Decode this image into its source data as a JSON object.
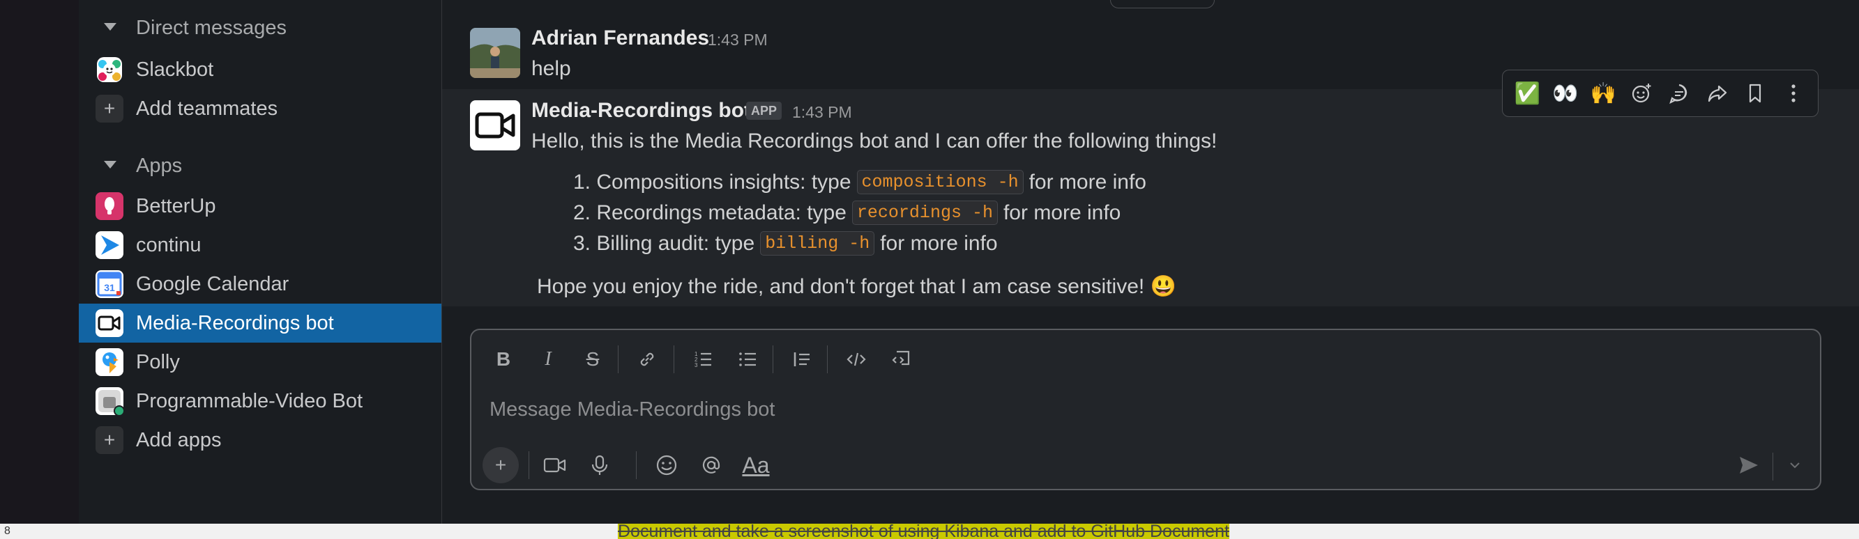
{
  "sidebar": {
    "dm_section": "Direct messages",
    "slackbot": "Slackbot",
    "add_teammates": "Add teammates",
    "apps_section": "Apps",
    "apps": [
      {
        "label": "BetterUp"
      },
      {
        "label": "continu"
      },
      {
        "label": "Google Calendar"
      },
      {
        "label": "Media-Recordings bot"
      },
      {
        "label": "Polly"
      },
      {
        "label": "Programmable-Video Bot"
      }
    ],
    "add_apps": "Add apps",
    "calendar_day": "31"
  },
  "messages": [
    {
      "author": "Adrian Fernandes",
      "time": "1:43 PM",
      "text": "help"
    },
    {
      "author": "Media-Recordings bot",
      "badge": "APP",
      "time": "1:43 PM",
      "intro": "Hello, this is the Media Recordings bot and I can offer the following things!",
      "items": [
        {
          "num": "1.",
          "pre": "Compositions insights: type",
          "code": "compositions -h",
          "post": "for more info"
        },
        {
          "num": "2.",
          "pre": "Recordings metadata: type",
          "code": "recordings -h",
          "post": "for more info"
        },
        {
          "num": "3.",
          "pre": "Billing audit: type",
          "code": "billing -h",
          "post": "for more info"
        }
      ],
      "outro": "Hope you enjoy the ride, and don't forget that I am case sensitive!",
      "outro_emoji": "😃"
    }
  ],
  "hover_actions": {
    "check": "✅",
    "eyes": "👀",
    "raised_hands": "🙌"
  },
  "composer": {
    "placeholder": "Message Media-Recordings bot"
  },
  "bottom_strip": {
    "text": "Document and take a screenshot of using Kibana and add to GitHub Document",
    "left_char": "8"
  },
  "colors": {
    "active": "#1264a3",
    "code": "#e8912d",
    "background": "#1a1d21"
  }
}
